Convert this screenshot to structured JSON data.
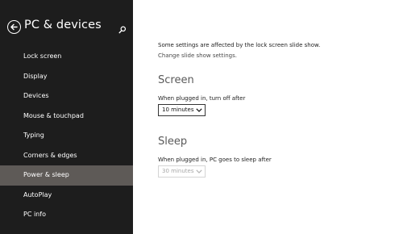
{
  "header": {
    "title": "PC & devices"
  },
  "sidebar": {
    "items": [
      {
        "label": "Lock screen"
      },
      {
        "label": "Display"
      },
      {
        "label": "Devices"
      },
      {
        "label": "Mouse & touchpad"
      },
      {
        "label": "Typing"
      },
      {
        "label": "Corners & edges"
      },
      {
        "label": "Power & sleep",
        "selected": true
      },
      {
        "label": "AutoPlay"
      },
      {
        "label": "PC info"
      }
    ]
  },
  "main": {
    "note": "Some settings are affected by the lock screen slide show.",
    "link": "Change slide show settings.",
    "screen": {
      "title": "Screen",
      "label": "When plugged in, turn off after",
      "value": "10 minutes"
    },
    "sleep": {
      "title": "Sleep",
      "label": "When plugged in, PC goes to sleep after",
      "value": "30 minutes"
    }
  },
  "colors": {
    "sidebar_bg": "#1d1d1d",
    "selected_bg": "#5e5a57",
    "content_bg": "#ffffff"
  },
  "icons": [
    "back-arrow-icon",
    "search-icon",
    "chevron-down-icon"
  ]
}
